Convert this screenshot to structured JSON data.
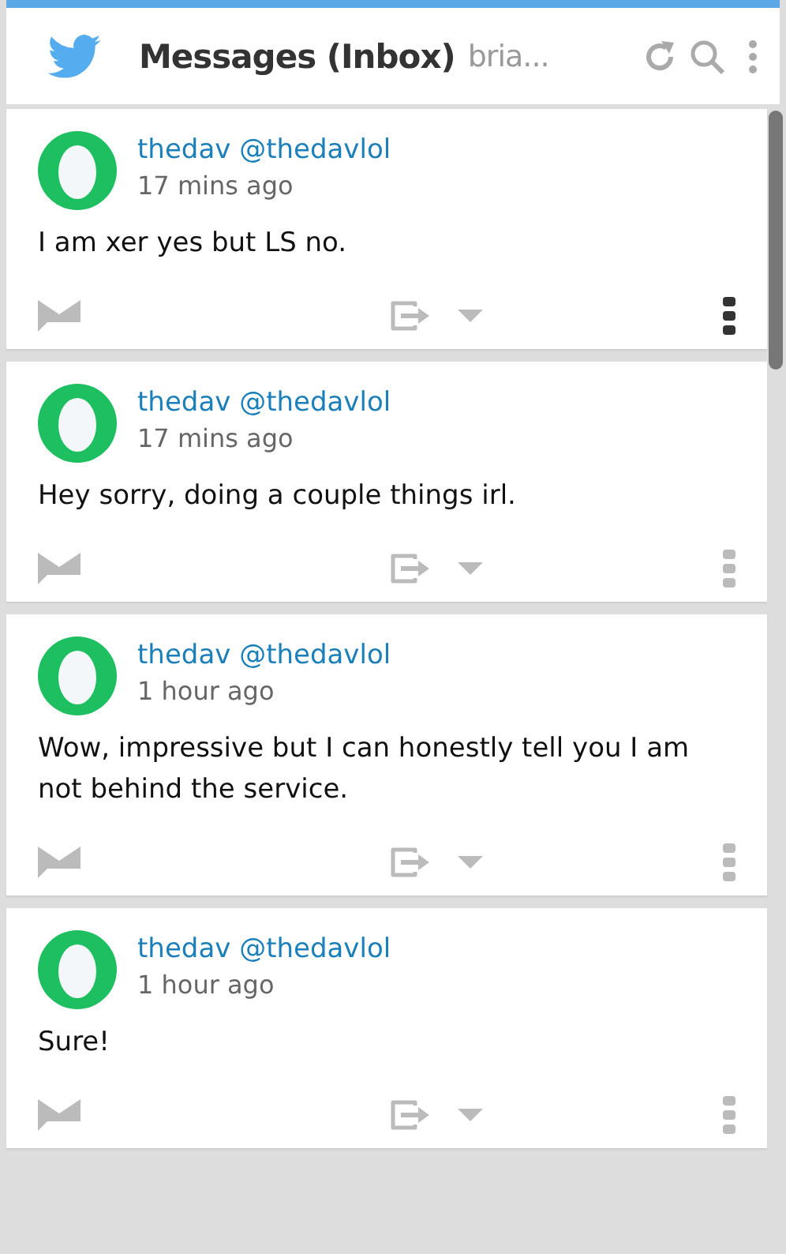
{
  "header": {
    "title": "Messages (Inbox)",
    "subtitle": "bria..."
  },
  "messages": [
    {
      "name": "thedav",
      "handle": "@thedavlol",
      "time": "17 mins ago",
      "text": "I am xer yes but LS no.",
      "menu_active": true
    },
    {
      "name": "thedav",
      "handle": "@thedavlol",
      "time": "17 mins ago",
      "text": "Hey sorry, doing a couple things irl.",
      "menu_active": false
    },
    {
      "name": "thedav",
      "handle": "@thedavlol",
      "time": "1 hour ago",
      "text": "Wow, impressive but I can honestly tell you I am not behind the service.",
      "menu_active": false
    },
    {
      "name": "thedav",
      "handle": "@thedavlol",
      "time": "1 hour ago",
      "text": "Sure!",
      "menu_active": false
    }
  ]
}
